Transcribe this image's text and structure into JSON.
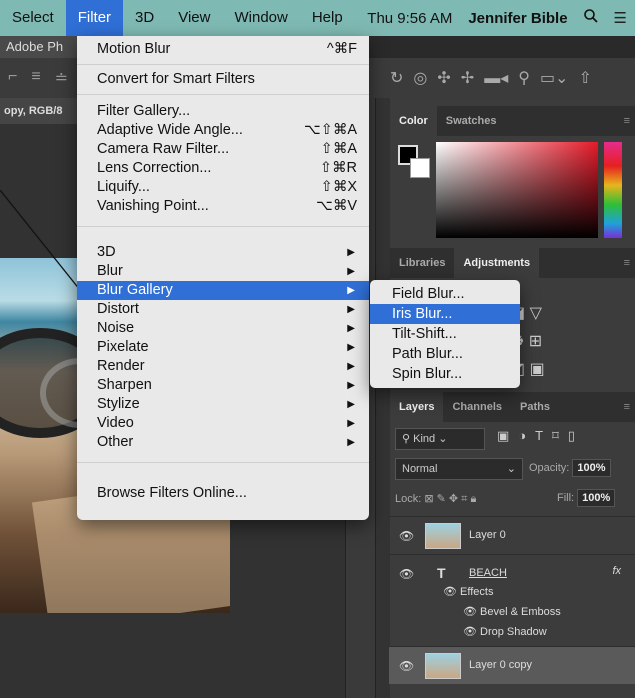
{
  "menubar": {
    "items": [
      "Select",
      "Filter",
      "3D",
      "View",
      "Window",
      "Help"
    ],
    "active": "Filter",
    "clock": "Thu 9:56 AM",
    "user": "Jennifer Bible",
    "search_icon": "search-icon",
    "list_icon": "list-icon"
  },
  "app": {
    "title": "Adobe Ph",
    "doc_tab": "opy, RGB/8"
  },
  "filter_menu": {
    "last_filter": {
      "label": "Motion Blur",
      "shortcut": "^⌘F"
    },
    "convert": "Convert for Smart Filters",
    "group1": [
      {
        "label": "Filter Gallery...",
        "shortcut": ""
      },
      {
        "label": "Adaptive Wide Angle...",
        "shortcut": "⌥⇧⌘A"
      },
      {
        "label": "Camera Raw Filter...",
        "shortcut": "⇧⌘A"
      },
      {
        "label": "Lens Correction...",
        "shortcut": "⇧⌘R"
      },
      {
        "label": "Liquify...",
        "shortcut": "⇧⌘X"
      },
      {
        "label": "Vanishing Point...",
        "shortcut": "⌥⌘V"
      }
    ],
    "group2": [
      "3D",
      "Blur",
      "Blur Gallery",
      "Distort",
      "Noise",
      "Pixelate",
      "Render",
      "Sharpen",
      "Stylize",
      "Video",
      "Other"
    ],
    "highlighted": "Blur Gallery",
    "browse": "Browse Filters Online..."
  },
  "blur_gallery_submenu": {
    "items": [
      "Field Blur...",
      "Iris Blur...",
      "Tilt-Shift...",
      "Path Blur...",
      "Spin Blur..."
    ],
    "highlighted": "Iris Blur..."
  },
  "color_panel": {
    "tabs": [
      "Color",
      "Swatches"
    ],
    "active": "Color"
  },
  "adjustments_panel": {
    "tabs": [
      "Libraries",
      "Adjustments"
    ],
    "active": "Adjustments"
  },
  "layers_panel": {
    "tabs": [
      "Layers",
      "Channels",
      "Paths"
    ],
    "active": "Layers",
    "kind": "Kind",
    "blend_mode": "Normal",
    "opacity_label": "Opacity:",
    "opacity_value": "100%",
    "lock_label": "Lock:",
    "fill_label": "Fill:",
    "fill_value": "100%",
    "layers": [
      {
        "name": "Layer 0"
      },
      {
        "name": "BEACH",
        "type": "text",
        "fx": "fx"
      },
      {
        "name": "Layer 0 copy",
        "selected": true
      }
    ],
    "effects_label": "Effects",
    "effects": [
      "Bevel & Emboss",
      "Drop Shadow"
    ]
  },
  "colors": {
    "menubar": "#7fb9b3",
    "highlight": "#2f6fd6",
    "menu_bg": "#e9e9e9"
  }
}
